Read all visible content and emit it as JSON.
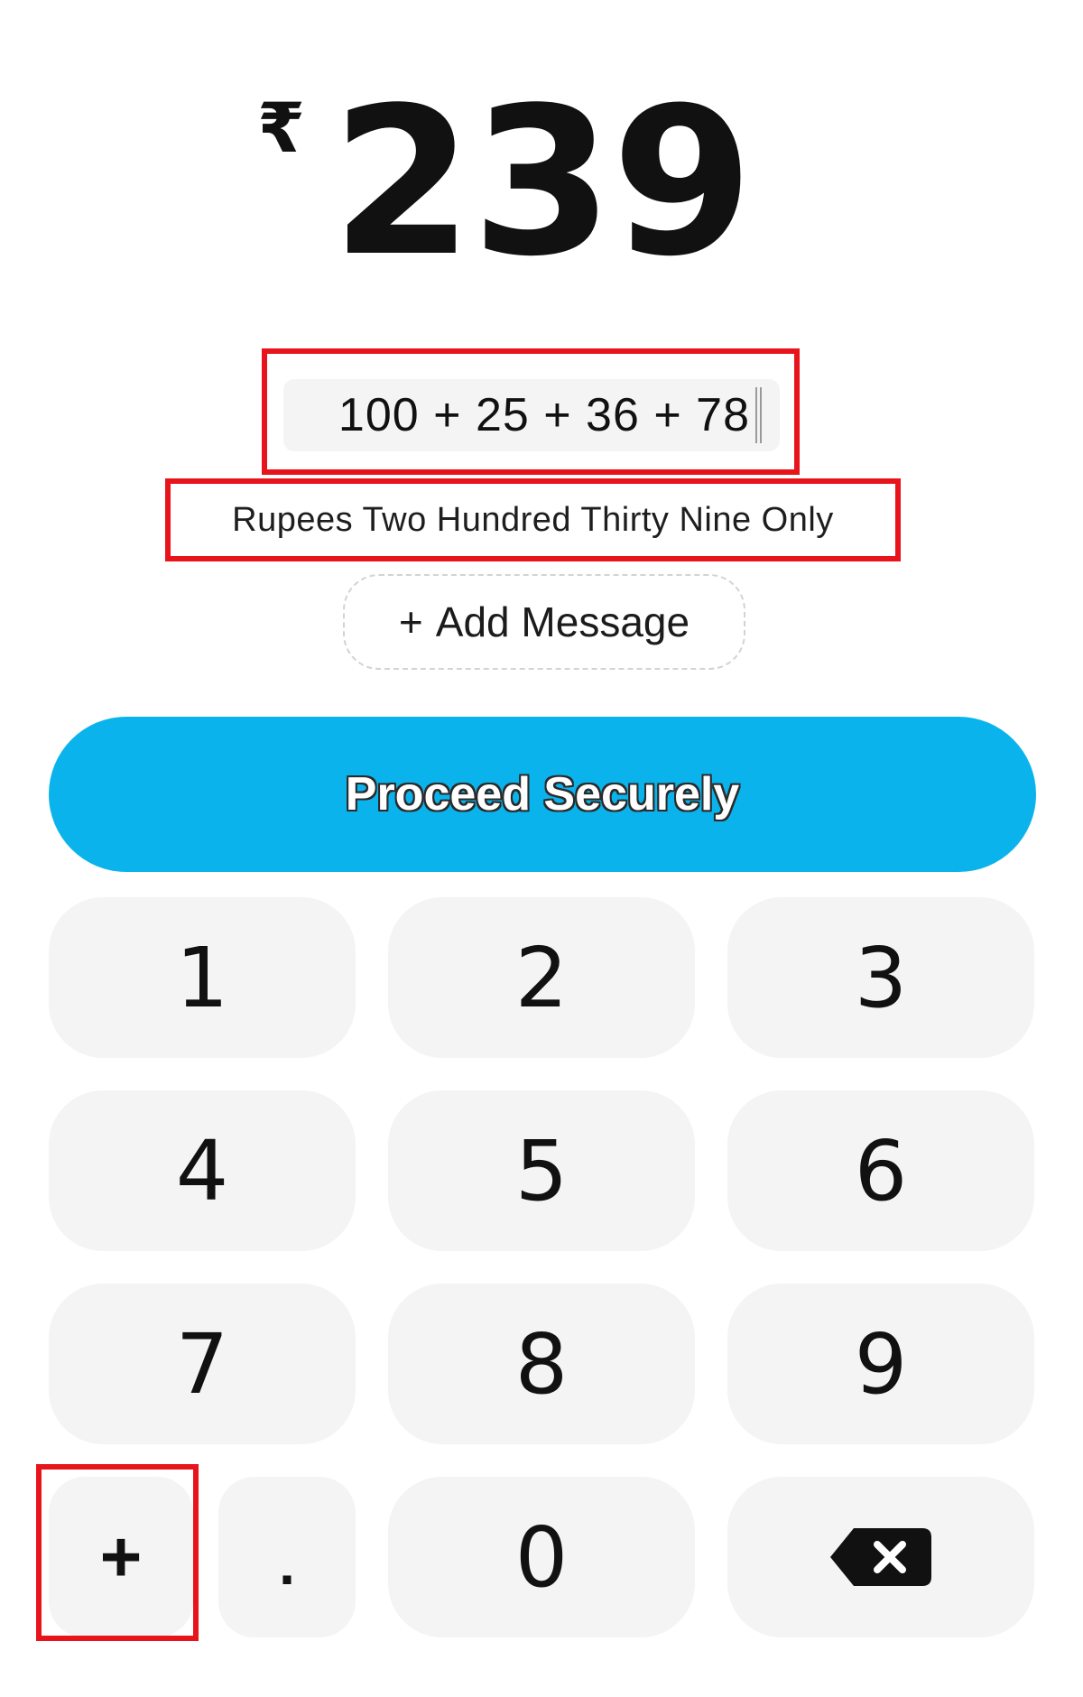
{
  "amount": {
    "currency_symbol": "₹",
    "value": "239"
  },
  "expression": {
    "text": "100 + 25 + 36 + 78"
  },
  "amount_in_words": "Rupees Two Hundred Thirty Nine Only",
  "add_message": {
    "plus": "+",
    "label": "Add Message"
  },
  "proceed_button": {
    "label": "Proceed Securely"
  },
  "keypad": {
    "k1": "1",
    "k2": "2",
    "k3": "3",
    "k4": "4",
    "k5": "5",
    "k6": "6",
    "k7": "7",
    "k8": "8",
    "k9": "9",
    "k0": "0",
    "plus": "+",
    "dot": ".",
    "backspace_icon": "backspace-icon"
  },
  "colors": {
    "accent": "#0bb3ec",
    "highlight": "#e8141b",
    "key_bg": "#f4f4f5"
  }
}
